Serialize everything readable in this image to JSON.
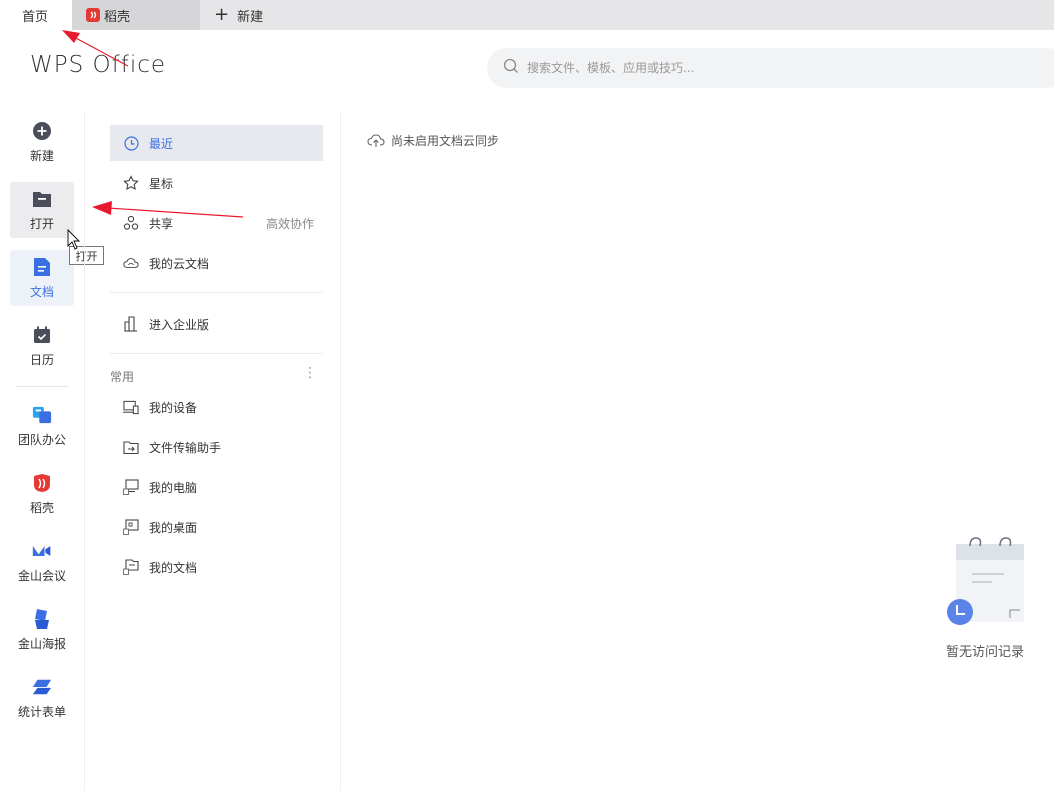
{
  "tabs": [
    {
      "label": "首页"
    },
    {
      "label": "稻壳"
    },
    {
      "label": "新建"
    }
  ],
  "header": {
    "logo": "WPS Office",
    "search_placeholder": "搜索文件、模板、应用或技巧..."
  },
  "rail": [
    {
      "label": "新建",
      "icon": "plus-circle-icon"
    },
    {
      "label": "打开",
      "icon": "folder-icon"
    },
    {
      "label": "文档",
      "icon": "document-icon"
    },
    {
      "label": "日历",
      "icon": "calendar-icon"
    },
    {
      "label": "团队办公",
      "icon": "team-office-icon"
    },
    {
      "label": "稻壳",
      "icon": "daoke-icon"
    },
    {
      "label": "金山会议",
      "icon": "meeting-icon"
    },
    {
      "label": "金山海报",
      "icon": "poster-icon"
    },
    {
      "label": "统计表单",
      "icon": "form-icon"
    }
  ],
  "tooltip": "打开",
  "nav": {
    "items": [
      {
        "label": "最近",
        "icon": "clock-icon"
      },
      {
        "label": "星标",
        "icon": "star-icon"
      },
      {
        "label": "共享",
        "icon": "share-icon",
        "right": "高效协作"
      },
      {
        "label": "我的云文档",
        "icon": "cloud-icon"
      },
      {
        "label": "进入企业版",
        "icon": "enterprise-icon"
      }
    ],
    "section_label": "常用",
    "common": [
      {
        "label": "我的设备",
        "icon": "device-icon"
      },
      {
        "label": "文件传输助手",
        "icon": "transfer-icon"
      },
      {
        "label": "我的电脑",
        "icon": "computer-icon"
      },
      {
        "label": "我的桌面",
        "icon": "desktop-icon"
      },
      {
        "label": "我的文档",
        "icon": "my-docs-icon"
      }
    ]
  },
  "main": {
    "sync_notice": "尚未启用文档云同步",
    "empty_text": "暂无访问记录"
  },
  "colors": {
    "accent": "#3a6fe4",
    "annotation_arrow": "#e8192c"
  }
}
